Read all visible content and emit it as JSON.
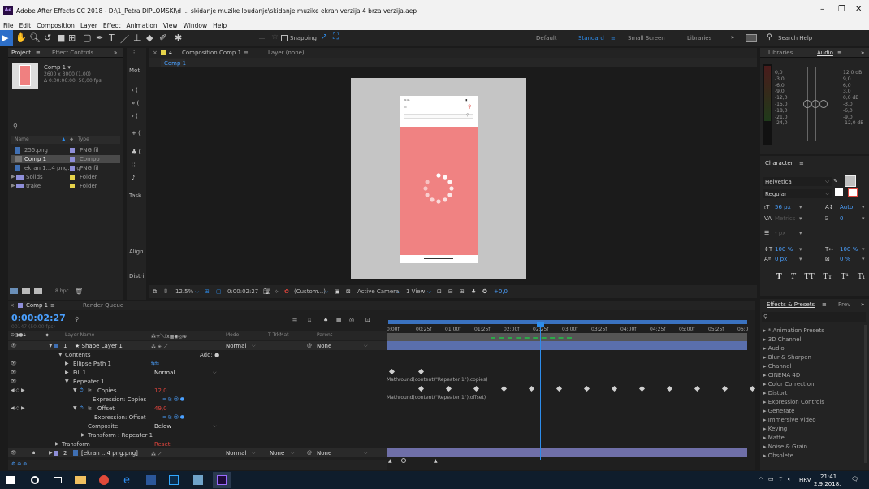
{
  "window": {
    "title": "Adobe After Effects CC 2018 - D:\\1_Petra DIPLOMSKI\\d ... skidanje muzike loudanje\\skidanje muzike ekran verzija 4 brza verzija.aep",
    "app_icon": "Ae",
    "controls": [
      "–",
      "❐",
      "✕"
    ]
  },
  "menu": [
    "File",
    "Edit",
    "Composition",
    "Layer",
    "Effect",
    "Animation",
    "View",
    "Window",
    "Help"
  ],
  "toolbar": {
    "snapping_label": "Snapping",
    "workspaces": [
      "Default",
      "Standard",
      "Small Screen",
      "Libraries"
    ],
    "active_workspace": "Standard",
    "search_placeholder": "Search Help"
  },
  "project": {
    "tab": "Project",
    "tab2": "Effect Controls",
    "comp_name": "Comp 1 ▾",
    "comp_size": "2600 x 3000 (1,00)",
    "comp_duration": "Δ 0:00:06:00, 50,00 fps",
    "col_name": "Name",
    "col_type": "Type",
    "items": [
      {
        "name": "255.png",
        "type": "PNG fil",
        "color": "#8e8ed8"
      },
      {
        "name": "Comp 1",
        "type": "Compo",
        "color": "#8e8ed8"
      },
      {
        "name": "ekran 1...4 png.png",
        "type": "PNG fil",
        "color": "#8e8ed8"
      },
      {
        "name": "Solids",
        "type": "Folder",
        "color": "#e6d34a"
      },
      {
        "name": "trake",
        "type": "Folder",
        "color": "#e6d34a"
      }
    ],
    "bpc": "8 bpc"
  },
  "motion_panel": {
    "labels": [
      "Mot",
      "Task",
      "Align",
      "Distri"
    ]
  },
  "composition": {
    "tab": "Composition Comp 1",
    "layer_tab": "Layer (none)",
    "breadcrumb": "Comp 1",
    "zoom": "12.5%",
    "timecode": "0:00:02:27",
    "resolution": "(Custom...)",
    "camera": "Active Camera",
    "view": "1 View",
    "exposure": "+0,0",
    "phone_status_time": "9:41"
  },
  "libraries": {
    "tab": "Libraries",
    "audio_tab": "Audio",
    "left_scale": [
      "0,0",
      "-3,0",
      "-6,0",
      "-9,0",
      "-12,0",
      "-15,0",
      "-18,0",
      "-21,0",
      "-24,0"
    ],
    "right_scale": [
      "12,0 dB",
      "9,0",
      "6,0",
      "3,0",
      "0,0 dB",
      "-3,0",
      "-6,0",
      "-9,0",
      "-12,0 dB"
    ]
  },
  "character": {
    "tab": "Character",
    "font": "Helvetica",
    "style": "Regular",
    "size": "56 px",
    "leading": "Auto",
    "kerning": "Metrics",
    "tracking": "0",
    "stroke": "- px",
    "vscale": "100 %",
    "hscale": "100 %",
    "baseline": "0 px",
    "tsume": "0 %",
    "styles": [
      "T",
      "T",
      "TT",
      "Tт",
      "T¹",
      "T₁"
    ]
  },
  "effects": {
    "tab": "Effects & Presets",
    "tab2": "Prev",
    "items": [
      "▸ * Animation Presets",
      "▸ 3D Channel",
      "▸ Audio",
      "▸ Blur & Sharpen",
      "▸ Channel",
      "▸ CINEMA 4D",
      "▸ Color Correction",
      "▸ Distort",
      "▸ Expression Controls",
      "▸ Generate",
      "▸ Immersive Video",
      "▸ Keying",
      "▸ Matte",
      "▸ Noise & Grain",
      "▸ Obsolete"
    ]
  },
  "timeline": {
    "tab": "Comp 1",
    "render_tab": "Render Queue",
    "timecode": "0:00:02:27",
    "fps_note": "00147 (50.00 fps)",
    "col_layer_name": "Layer Name",
    "col_mode": "Mode",
    "col_trkmat": "T  TrkMat",
    "col_parent": "Parent",
    "ruler": [
      "0:00f",
      "00:25f",
      "01:00f",
      "01:25f",
      "02:00f",
      "02:25f",
      "03:00f",
      "03:25f",
      "04:00f",
      "04:25f",
      "05:00f",
      "05:25f",
      "06:0"
    ],
    "rows": [
      {
        "num": "1",
        "name": "★ Shape Layer 1",
        "mode": "Normal",
        "parent": "None"
      },
      {
        "name": "Contents",
        "add": "Add: ●"
      },
      {
        "name": "Ellipse Path 1"
      },
      {
        "name": "Fill 1",
        "value": "Normal"
      },
      {
        "name": "Repeater 1"
      },
      {
        "name": "Copies",
        "value": "12,0"
      },
      {
        "name": "Expression: Copies",
        "expr": "Mathround(content(\"Repeater 1\").copies)"
      },
      {
        "name": "Offset",
        "value": "49,0"
      },
      {
        "name": "Expression: Offset",
        "expr": "Mathround(content(\"Repeater 1\").offset)"
      },
      {
        "name": "Composite",
        "value": "Below"
      },
      {
        "name": "Transform : Repeater 1"
      },
      {
        "name": "Transform",
        "value": "Reset"
      },
      {
        "num": "2",
        "name": "[ekran ...4 png.png]",
        "mode": "Normal",
        "trkmat": "None",
        "parent": "None"
      }
    ]
  },
  "taskbar": {
    "lang": "HRV",
    "time": "21:41",
    "date": "2.9.2018."
  }
}
